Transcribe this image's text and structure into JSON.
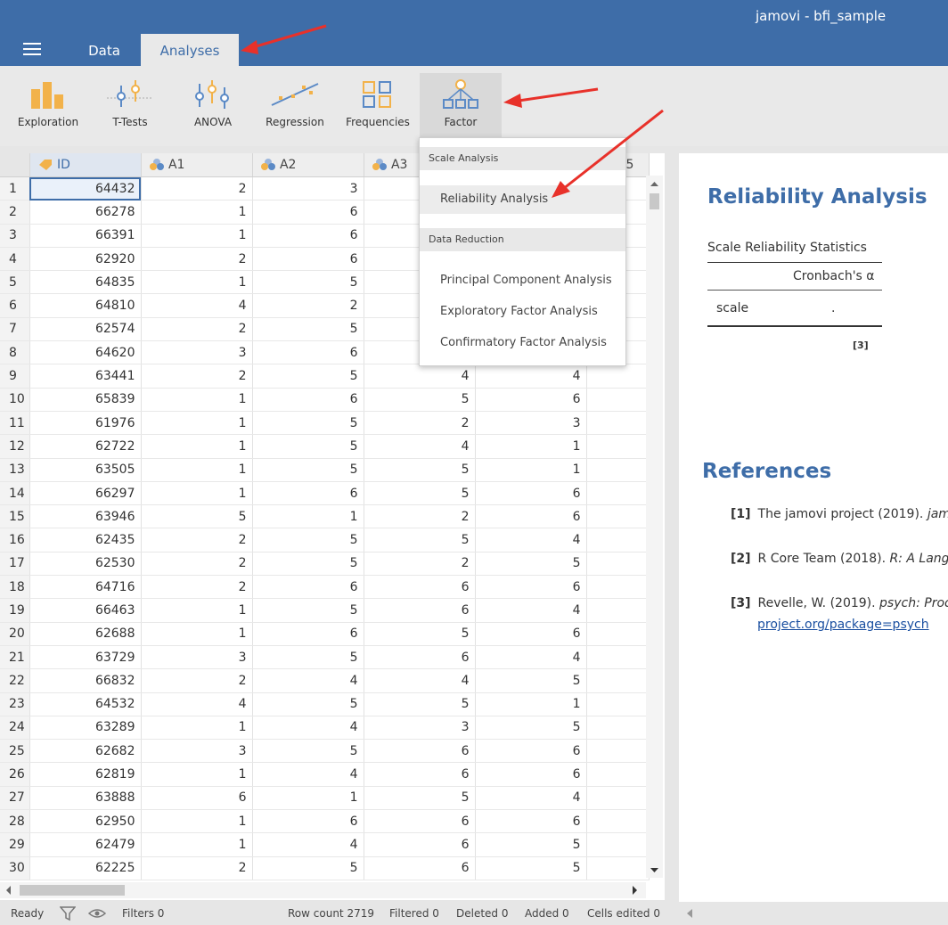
{
  "app": {
    "title": "jamovi - bfi_sample"
  },
  "tabs": [
    {
      "label": "Data"
    },
    {
      "label": "Analyses"
    }
  ],
  "ribbon": [
    {
      "label": "Exploration",
      "icon": "exploration-icon"
    },
    {
      "label": "T-Tests",
      "icon": "t-tests-icon"
    },
    {
      "label": "ANOVA",
      "icon": "anova-icon"
    },
    {
      "label": "Regression",
      "icon": "regression-icon"
    },
    {
      "label": "Frequencies",
      "icon": "frequencies-icon"
    },
    {
      "label": "Factor",
      "icon": "factor-icon"
    }
  ],
  "grid": {
    "columns": [
      {
        "name": "ID",
        "type": "id"
      },
      {
        "name": "A1",
        "type": "ordinal"
      },
      {
        "name": "A2",
        "type": "ordinal"
      },
      {
        "name": "A3",
        "type": "ordinal"
      },
      {
        "name": "",
        "type": "ordinal"
      },
      {
        "name": "5",
        "type": "ordinal"
      }
    ],
    "rows": [
      [
        "64432",
        "2",
        "3",
        "",
        "",
        ""
      ],
      [
        "66278",
        "1",
        "6",
        "",
        "",
        ""
      ],
      [
        "66391",
        "1",
        "6",
        "",
        "",
        ""
      ],
      [
        "62920",
        "2",
        "6",
        "",
        "",
        ""
      ],
      [
        "64835",
        "1",
        "5",
        "",
        "",
        ""
      ],
      [
        "64810",
        "4",
        "2",
        "",
        "",
        ""
      ],
      [
        "62574",
        "2",
        "5",
        "",
        "",
        ""
      ],
      [
        "64620",
        "3",
        "6",
        "",
        "",
        ""
      ],
      [
        "63441",
        "2",
        "5",
        "4",
        "4",
        ""
      ],
      [
        "65839",
        "1",
        "6",
        "5",
        "6",
        ""
      ],
      [
        "61976",
        "1",
        "5",
        "2",
        "3",
        ""
      ],
      [
        "62722",
        "1",
        "5",
        "4",
        "1",
        ""
      ],
      [
        "63505",
        "1",
        "5",
        "5",
        "1",
        ""
      ],
      [
        "66297",
        "1",
        "6",
        "5",
        "6",
        ""
      ],
      [
        "63946",
        "5",
        "1",
        "2",
        "6",
        ""
      ],
      [
        "62435",
        "2",
        "5",
        "5",
        "4",
        ""
      ],
      [
        "62530",
        "2",
        "5",
        "2",
        "5",
        ""
      ],
      [
        "64716",
        "2",
        "6",
        "6",
        "6",
        ""
      ],
      [
        "66463",
        "1",
        "5",
        "6",
        "4",
        ""
      ],
      [
        "62688",
        "1",
        "6",
        "5",
        "6",
        ""
      ],
      [
        "63729",
        "3",
        "5",
        "6",
        "4",
        ""
      ],
      [
        "66832",
        "2",
        "4",
        "4",
        "5",
        ""
      ],
      [
        "64532",
        "4",
        "5",
        "5",
        "1",
        ""
      ],
      [
        "63289",
        "1",
        "4",
        "3",
        "5",
        ""
      ],
      [
        "62682",
        "3",
        "5",
        "6",
        "6",
        ""
      ],
      [
        "62819",
        "1",
        "4",
        "6",
        "6",
        ""
      ],
      [
        "63888",
        "6",
        "1",
        "5",
        "4",
        ""
      ],
      [
        "62950",
        "1",
        "6",
        "6",
        "6",
        ""
      ],
      [
        "62479",
        "1",
        "4",
        "6",
        "5",
        ""
      ],
      [
        "62225",
        "2",
        "5",
        "6",
        "5",
        ""
      ]
    ]
  },
  "dropdown": {
    "sections": [
      {
        "title": "Scale Analysis",
        "items": [
          "Reliability Analysis"
        ]
      },
      {
        "title": "Data Reduction",
        "items": [
          "Principal Component Analysis",
          "Exploratory Factor Analysis",
          "Confirmatory Factor Analysis"
        ]
      }
    ]
  },
  "results": {
    "heading": "Reliability Analysis",
    "table_title": "Scale Reliability Statistics",
    "col_header": "Cronbach's α",
    "row_label": "scale",
    "row_value": ".",
    "footnote": "[3]",
    "references_heading": "References",
    "references": [
      {
        "num": "[1]",
        "text": "The jamovi project (2019).",
        "italic": "jam"
      },
      {
        "num": "[2]",
        "text": "R Core Team (2018).",
        "italic": "R: A Langu"
      },
      {
        "num": "[3]",
        "text": "Revelle, W. (2019).",
        "italic": "psych: Proce",
        "link": "project.org/package=psych"
      }
    ]
  },
  "status": {
    "ready": "Ready",
    "filters": "Filters 0",
    "row_count": "Row count 2719",
    "filtered": "Filtered 0",
    "deleted": "Deleted 0",
    "added": "Added 0",
    "cells_edited": "Cells edited 0"
  },
  "colors": {
    "accent": "#3e6da8",
    "annotation_arrow": "#e8312a"
  }
}
